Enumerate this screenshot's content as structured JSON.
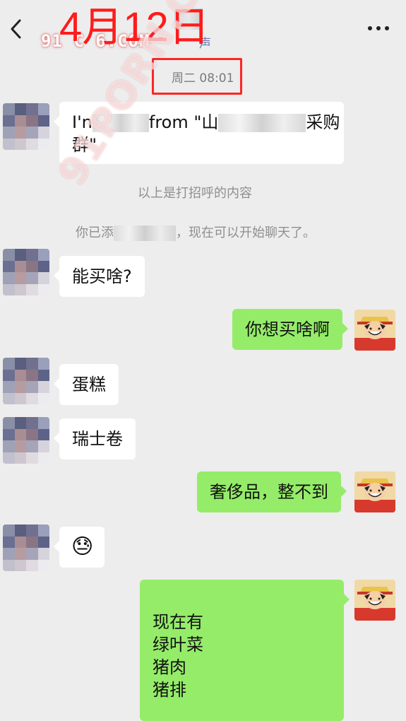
{
  "header": {
    "sub_label": "声",
    "watermark": "91 C 6.COM"
  },
  "annotation": {
    "date": "4月12日"
  },
  "timestamp": "周二 08:01",
  "messages": [
    {
      "side": "left",
      "text_part1": "I'n",
      "text_part2": "from \"山",
      "text_part3": "采购",
      "text_line2": "群\""
    },
    {
      "side": "left",
      "text": "能买啥?"
    },
    {
      "side": "right",
      "text": "你想买啥啊"
    },
    {
      "side": "left",
      "text": "蛋糕"
    },
    {
      "side": "left",
      "text": "瑞士卷"
    },
    {
      "side": "right",
      "text": "奢侈品，整不到"
    },
    {
      "side": "left",
      "text": "😓"
    },
    {
      "side": "right",
      "lines": [
        "现在有",
        "绿叶菜",
        "猪肉",
        "猪排"
      ]
    }
  ],
  "system": {
    "greeting_note": "以上是打招呼的内容",
    "added_prefix": "你已添",
    "added_suffix": "，现在可以开始聊天了。"
  },
  "watermark_diag": "91PORN.COM",
  "colors": {
    "background": "#ededed",
    "bubble_self": "#95ec69",
    "bubble_other": "#ffffff",
    "annotation_red": "#ff1b1b"
  },
  "icons": [
    "back-arrow-icon",
    "more-dots-icon"
  ]
}
